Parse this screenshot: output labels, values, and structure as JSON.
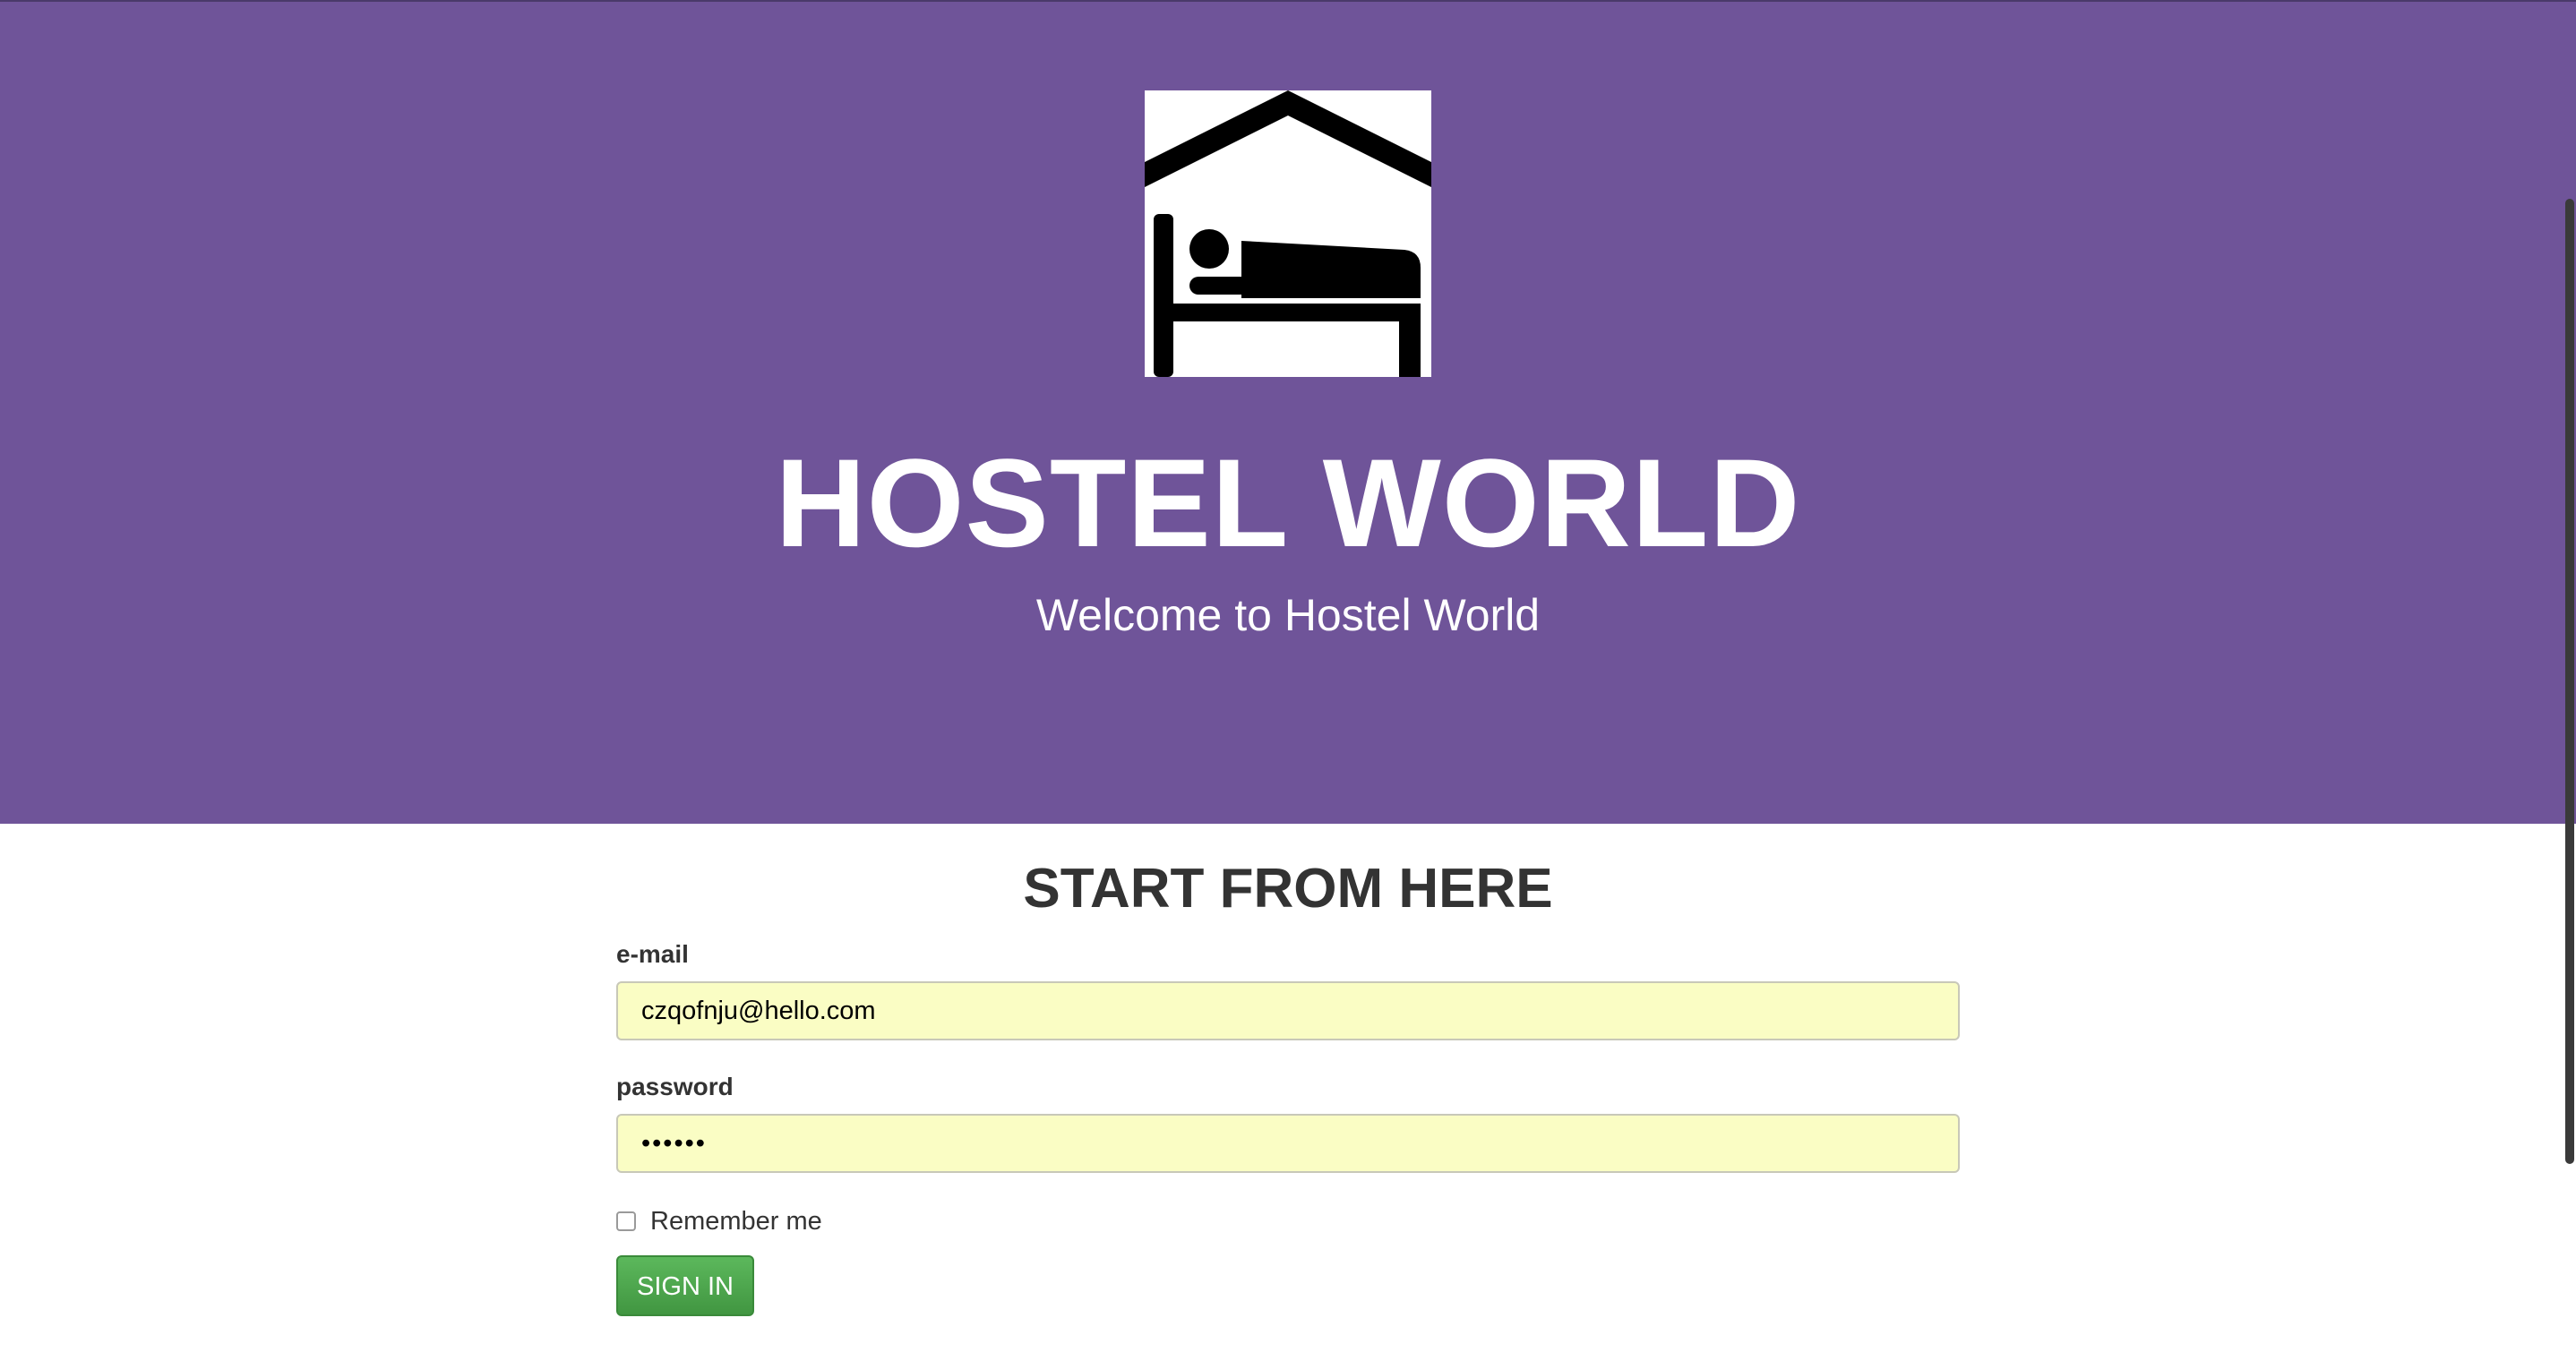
{
  "hero": {
    "logo_icon": "hostel-bed-icon",
    "brand_title": "HOSTEL WORLD",
    "tagline": "Welcome to Hostel World",
    "background_color": "#6f5499"
  },
  "login_form": {
    "heading": "START FROM HERE",
    "email": {
      "label": "e-mail",
      "value": "czqofnju@hello.com"
    },
    "password": {
      "label": "password",
      "value": "••••••"
    },
    "remember_me": {
      "label": "Remember me",
      "checked": false
    },
    "submit_label": "SIGN IN",
    "submit_color": "#4cae4c",
    "input_autofill_color": "#fafdc4"
  }
}
